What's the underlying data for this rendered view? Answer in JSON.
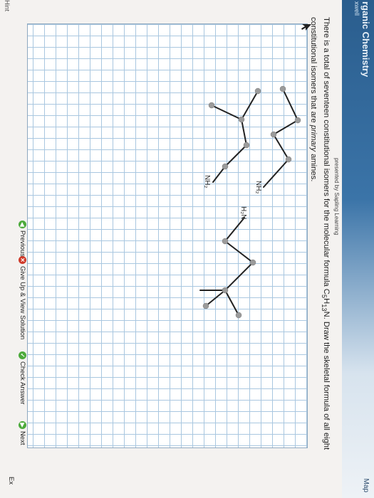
{
  "header": {
    "course_title": "rganic Chemistry",
    "course_sub": "xwell",
    "map_label": "Map"
  },
  "presenter": "presented by Sapling Learning",
  "question": {
    "part1": "There is a total of seventeen constitutional isomers for the molecular formula C",
    "sub1": "5",
    "part2": "H",
    "sub2": "13",
    "part3": "N. Draw the skeletal formula of all eight constitutional isomers that are ",
    "emph": "primary",
    "part4": " amines."
  },
  "molecules": {
    "amine_labels": [
      "NH₂",
      "NH₂",
      "H₂N"
    ]
  },
  "buttons": {
    "previous": "Previous",
    "give_up": "Give Up & View Solution",
    "check": "Check Answer",
    "next": "Next",
    "exit": "Ex",
    "hint": "Hint"
  }
}
